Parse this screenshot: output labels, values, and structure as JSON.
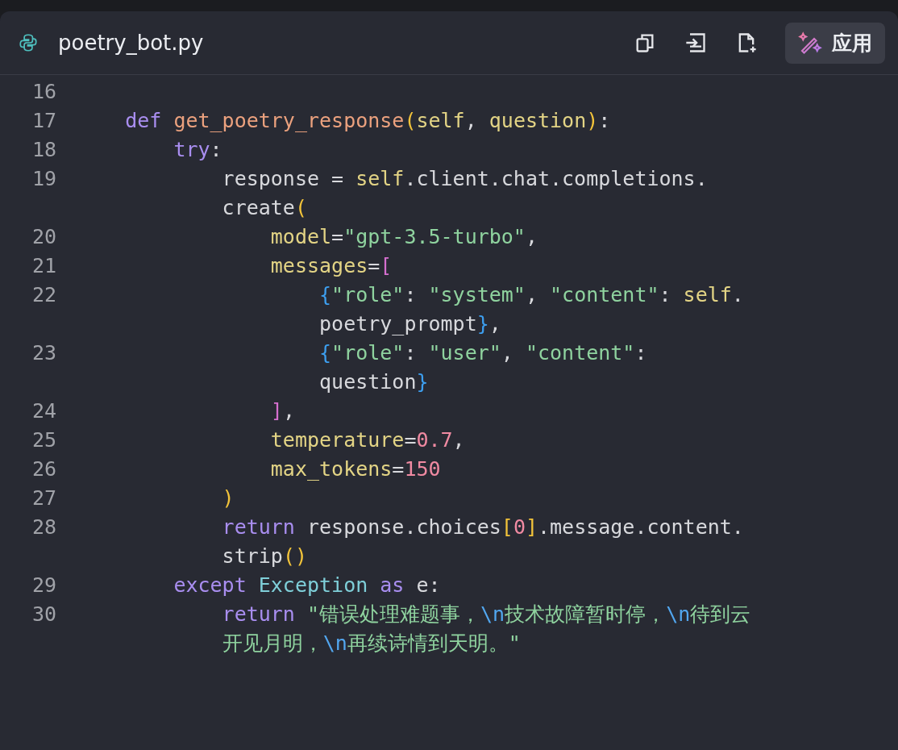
{
  "header": {
    "filename": "poetry_bot.py",
    "apply_button": "应用"
  },
  "lines": [
    {
      "number": "16"
    },
    {
      "number": "17",
      "rows": [
        {
          "tokens": [
            {
              "text": "    def",
              "kind": "keyword"
            },
            {
              "text": " get_poetry_response",
              "kind": "function"
            },
            {
              "text": "(",
              "kind": "paren"
            },
            {
              "text": "self",
              "kind": "name"
            },
            {
              "text": ", ",
              "kind": "plain"
            },
            {
              "text": "question",
              "kind": "name"
            },
            {
              "text": ")",
              "kind": "paren"
            },
            {
              "text": ":",
              "kind": "plain"
            }
          ]
        }
      ]
    },
    {
      "number": "18",
      "rows": [
        {
          "tokens": [
            {
              "text": "        try",
              "kind": "keyword"
            },
            {
              "text": ":",
              "kind": "plain"
            }
          ]
        }
      ]
    },
    {
      "number": "19",
      "rows": [
        {
          "tokens": [
            {
              "text": "            response = ",
              "kind": "plain"
            },
            {
              "text": "self",
              "kind": "name"
            },
            {
              "text": ".client.chat.completions.",
              "kind": "plain"
            }
          ]
        },
        {
          "tokens": [
            {
              "text": "            create",
              "kind": "plain"
            },
            {
              "text": "(",
              "kind": "paren"
            }
          ]
        }
      ]
    },
    {
      "number": "20",
      "rows": [
        {
          "tokens": [
            {
              "text": "                model",
              "kind": "name"
            },
            {
              "text": "=",
              "kind": "plain"
            },
            {
              "text": "\"gpt-3.5-turbo\"",
              "kind": "string"
            },
            {
              "text": ",",
              "kind": "plain"
            }
          ]
        }
      ]
    },
    {
      "number": "21",
      "rows": [
        {
          "tokens": [
            {
              "text": "                messages",
              "kind": "name"
            },
            {
              "text": "=",
              "kind": "plain"
            },
            {
              "text": "[",
              "kind": "bracket"
            }
          ]
        }
      ]
    },
    {
      "number": "22",
      "rows": [
        {
          "tokens": [
            {
              "text": "                    {",
              "kind": "brace"
            },
            {
              "text": "\"role\"",
              "kind": "string"
            },
            {
              "text": ": ",
              "kind": "plain"
            },
            {
              "text": "\"system\"",
              "kind": "string"
            },
            {
              "text": ", ",
              "kind": "plain"
            },
            {
              "text": "\"content\"",
              "kind": "string"
            },
            {
              "text": ": ",
              "kind": "plain"
            },
            {
              "text": "self",
              "kind": "name"
            },
            {
              "text": ".",
              "kind": "plain"
            }
          ]
        },
        {
          "tokens": [
            {
              "text": "                    poetry_prompt",
              "kind": "plain"
            },
            {
              "text": "}",
              "kind": "brace"
            },
            {
              "text": ",",
              "kind": "plain"
            }
          ]
        }
      ]
    },
    {
      "number": "23",
      "rows": [
        {
          "tokens": [
            {
              "text": "                    {",
              "kind": "brace"
            },
            {
              "text": "\"role\"",
              "kind": "string"
            },
            {
              "text": ": ",
              "kind": "plain"
            },
            {
              "text": "\"user\"",
              "kind": "string"
            },
            {
              "text": ", ",
              "kind": "plain"
            },
            {
              "text": "\"content\"",
              "kind": "string"
            },
            {
              "text": ":",
              "kind": "plain"
            }
          ]
        },
        {
          "tokens": [
            {
              "text": "                    question",
              "kind": "plain"
            },
            {
              "text": "}",
              "kind": "brace"
            }
          ]
        }
      ]
    },
    {
      "number": "24",
      "rows": [
        {
          "tokens": [
            {
              "text": "                ]",
              "kind": "bracket"
            },
            {
              "text": ",",
              "kind": "plain"
            }
          ]
        }
      ]
    },
    {
      "number": "25",
      "rows": [
        {
          "tokens": [
            {
              "text": "                temperature",
              "kind": "name"
            },
            {
              "text": "=",
              "kind": "plain"
            },
            {
              "text": "0.7",
              "kind": "number"
            },
            {
              "text": ",",
              "kind": "plain"
            }
          ]
        }
      ]
    },
    {
      "number": "26",
      "rows": [
        {
          "tokens": [
            {
              "text": "                max_tokens",
              "kind": "name"
            },
            {
              "text": "=",
              "kind": "plain"
            },
            {
              "text": "150",
              "kind": "number"
            }
          ]
        }
      ]
    },
    {
      "number": "27",
      "rows": [
        {
          "tokens": [
            {
              "text": "            )",
              "kind": "paren"
            }
          ]
        }
      ]
    },
    {
      "number": "28",
      "rows": [
        {
          "tokens": [
            {
              "text": "            return",
              "kind": "keyword"
            },
            {
              "text": " response.choices",
              "kind": "plain"
            },
            {
              "text": "[",
              "kind": "paren"
            },
            {
              "text": "0",
              "kind": "number"
            },
            {
              "text": "]",
              "kind": "paren"
            },
            {
              "text": ".message.content.",
              "kind": "plain"
            }
          ]
        },
        {
          "tokens": [
            {
              "text": "            strip",
              "kind": "plain"
            },
            {
              "text": "()",
              "kind": "paren"
            }
          ]
        }
      ]
    },
    {
      "number": "29",
      "rows": [
        {
          "tokens": [
            {
              "text": "        except",
              "kind": "keyword"
            },
            {
              "text": " Exception",
              "kind": "class"
            },
            {
              "text": " as",
              "kind": "keyword"
            },
            {
              "text": " e:",
              "kind": "plain"
            }
          ]
        }
      ]
    },
    {
      "number": "30",
      "rows": [
        {
          "tokens": [
            {
              "text": "            return",
              "kind": "keyword"
            },
            {
              "text": " \"错误处理难题事，",
              "kind": "string"
            },
            {
              "text": "\\n",
              "kind": "escape"
            },
            {
              "text": "技术故障暂时停，",
              "kind": "string"
            },
            {
              "text": "\\n",
              "kind": "escape"
            },
            {
              "text": "待到云",
              "kind": "string"
            }
          ]
        },
        {
          "tokens": [
            {
              "text": "            开见月明，",
              "kind": "string"
            },
            {
              "text": "\\n",
              "kind": "escape"
            },
            {
              "text": "再续诗情到天明。\"",
              "kind": "string"
            }
          ]
        }
      ]
    }
  ]
}
